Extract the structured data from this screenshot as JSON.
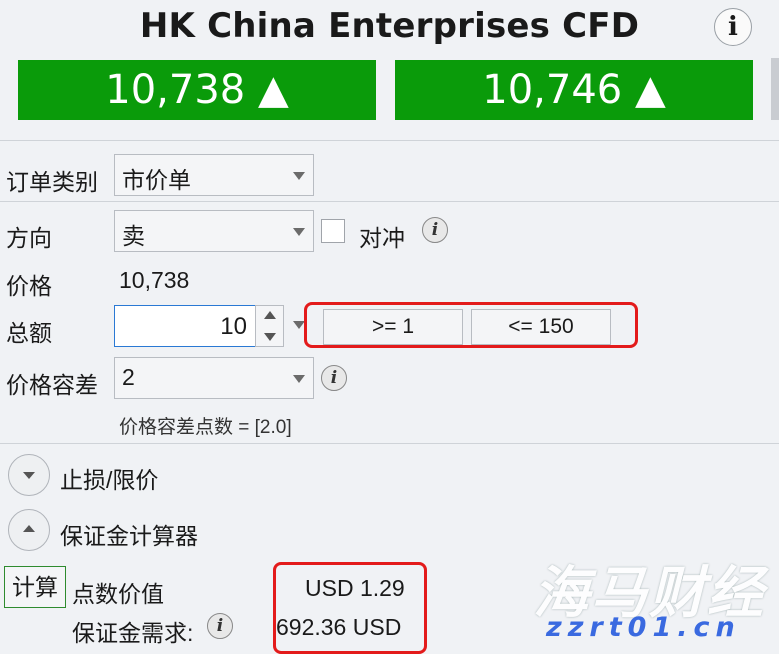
{
  "header": {
    "title": "HK China Enterprises CFD",
    "info_symbol": "i",
    "bid": "10,738 ▲",
    "ask": "10,746 ▲",
    "price_box_color": "#0a9b0a"
  },
  "form": {
    "order_type_label": "订单类别",
    "order_type_value": "市价单",
    "direction_label": "方向",
    "direction_value": "卖",
    "hedge_label": "对冲",
    "price_label": "价格",
    "price_value": "10,738",
    "quantity_label": "总额",
    "quantity_value": "10",
    "min_label": ">= 1",
    "max_label": "<= 150",
    "tolerance_label": "价格容差",
    "tolerance_value": "2",
    "tolerance_points": "价格容差点数 = [2.0]"
  },
  "sections": {
    "stop_limit": "止损/限价",
    "margin_calculator": "保证金计算器"
  },
  "calculator": {
    "calc_button": "计算",
    "point_value_label": "点数价值",
    "point_value": "USD 1.29",
    "margin_label": "保证金需求:",
    "margin_value": "692.36 USD"
  },
  "watermark": {
    "main": "海马财经",
    "sub": "zzrt01.cn"
  },
  "highlight_color": "#e31b1b"
}
